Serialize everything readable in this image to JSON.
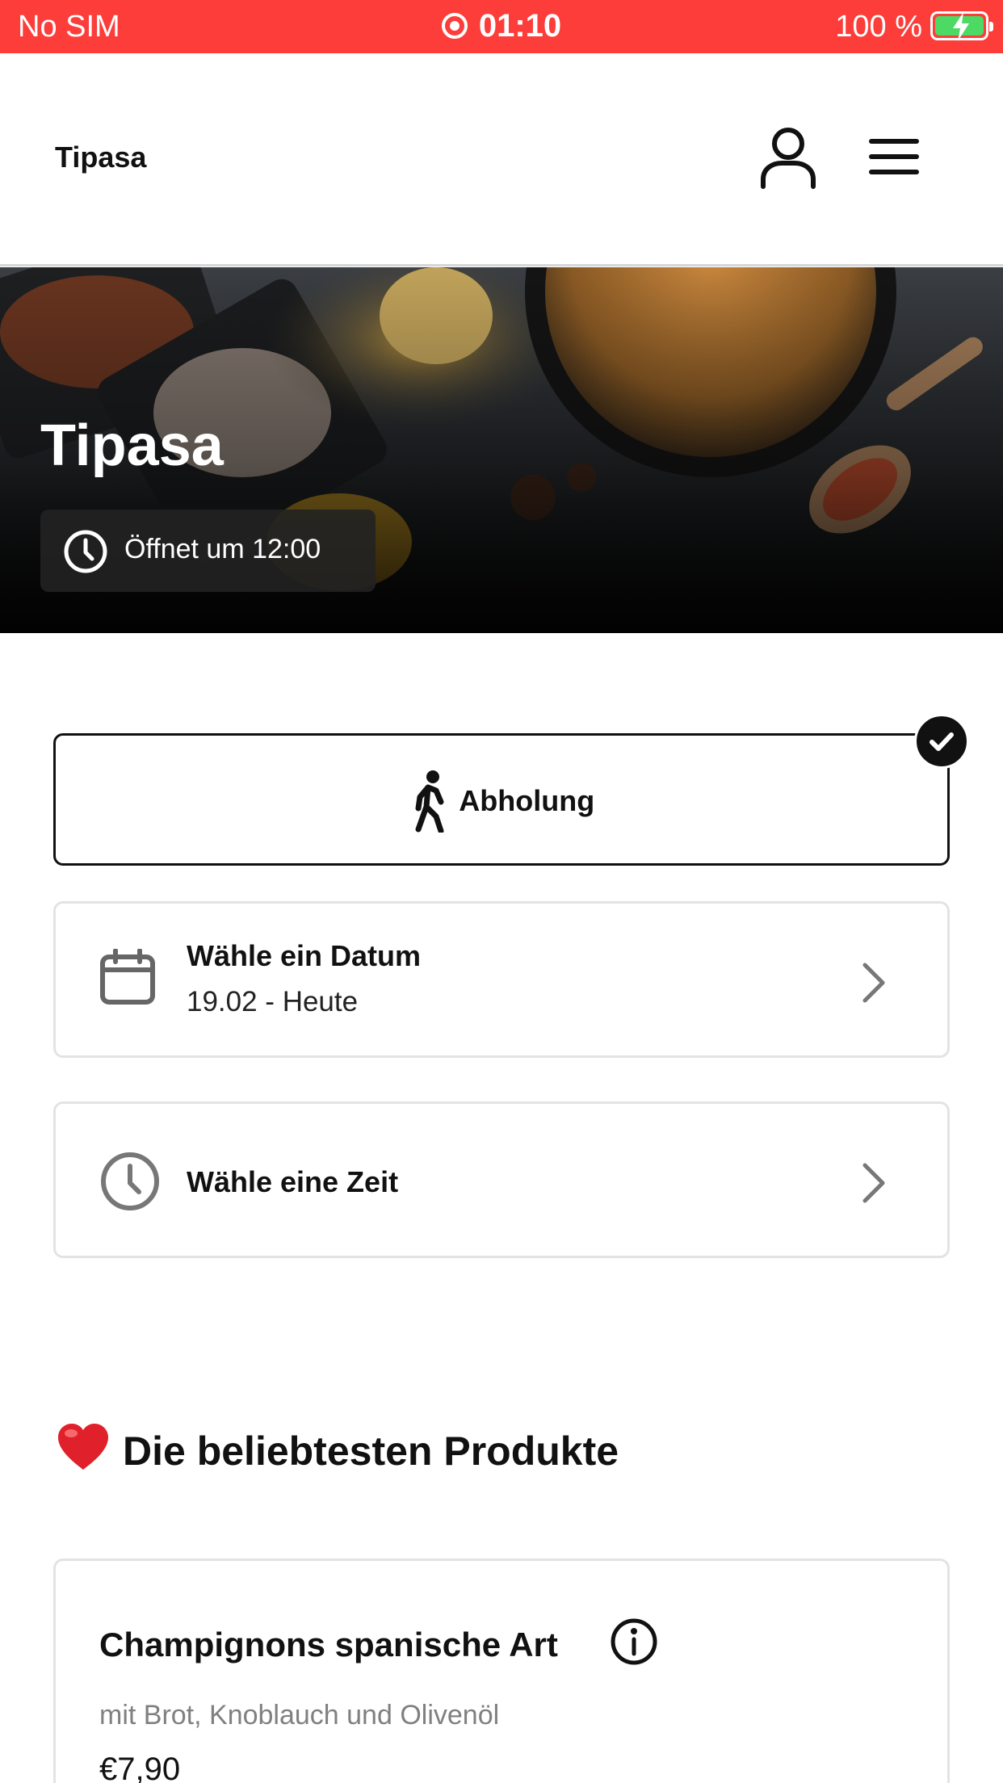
{
  "status_bar": {
    "carrier": "No SIM",
    "time": "01:10",
    "battery": "100 %",
    "colors": {
      "background": "#fc3d39",
      "battery_fill": "#4cd964"
    }
  },
  "header": {
    "brand": "Tipasa",
    "icons": [
      "user-icon",
      "hamburger-menu-icon"
    ]
  },
  "hero": {
    "title": "Tipasa",
    "opening_hours": "Öffnet um 12:00",
    "icon": "clock-icon"
  },
  "order_mode": {
    "label": "Abholung",
    "icon": "walking-person-icon",
    "selected": true
  },
  "date_picker": {
    "title": "Wähle ein Datum",
    "value": "19.02 - Heute",
    "icon": "calendar-icon"
  },
  "time_picker": {
    "title": "Wähle eine Zeit",
    "icon": "clock-icon"
  },
  "popular": {
    "heading": "Die beliebtesten Produkte",
    "icon": "heart-icon",
    "products": [
      {
        "name": "Champignons spanische Art",
        "description": "mit Brot, Knoblauch und Olivenöl",
        "price": "€7,90"
      }
    ]
  }
}
